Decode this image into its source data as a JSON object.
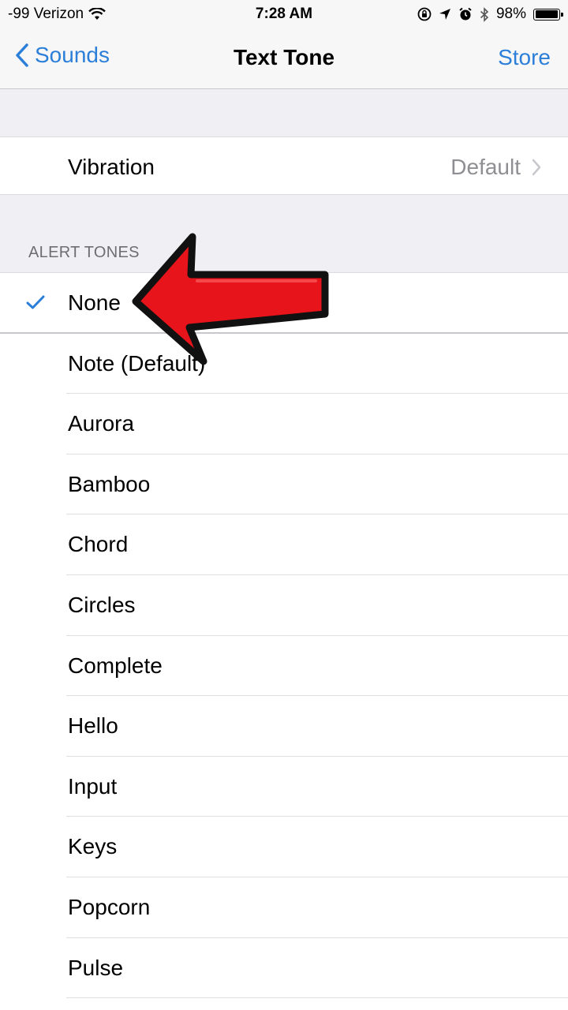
{
  "status_bar": {
    "carrier": "-99 Verizon",
    "time": "7:28 AM",
    "battery_percent": "98%",
    "battery_level": 0.98,
    "icons": [
      "wifi-icon",
      "screen-rotation-lock-icon",
      "location-arrow-icon",
      "alarm-icon",
      "bluetooth-icon",
      "battery-icon"
    ]
  },
  "nav": {
    "back_label": "Sounds",
    "title": "Text Tone",
    "right_label": "Store",
    "accent_color": "#2b7fd8"
  },
  "vibration": {
    "label": "Vibration",
    "value": "Default"
  },
  "alert_tones": {
    "header": "ALERT TONES",
    "selected": "None",
    "items": [
      {
        "label": "None",
        "selected": true
      },
      {
        "label": "Note (Default)",
        "selected": false
      },
      {
        "label": "Aurora",
        "selected": false
      },
      {
        "label": "Bamboo",
        "selected": false
      },
      {
        "label": "Chord",
        "selected": false
      },
      {
        "label": "Circles",
        "selected": false
      },
      {
        "label": "Complete",
        "selected": false
      },
      {
        "label": "Hello",
        "selected": false
      },
      {
        "label": "Input",
        "selected": false
      },
      {
        "label": "Keys",
        "selected": false
      },
      {
        "label": "Popcorn",
        "selected": false
      },
      {
        "label": "Pulse",
        "selected": false
      }
    ]
  },
  "annotation": {
    "icon": "red-arrow-icon",
    "color": "#e8141b"
  }
}
